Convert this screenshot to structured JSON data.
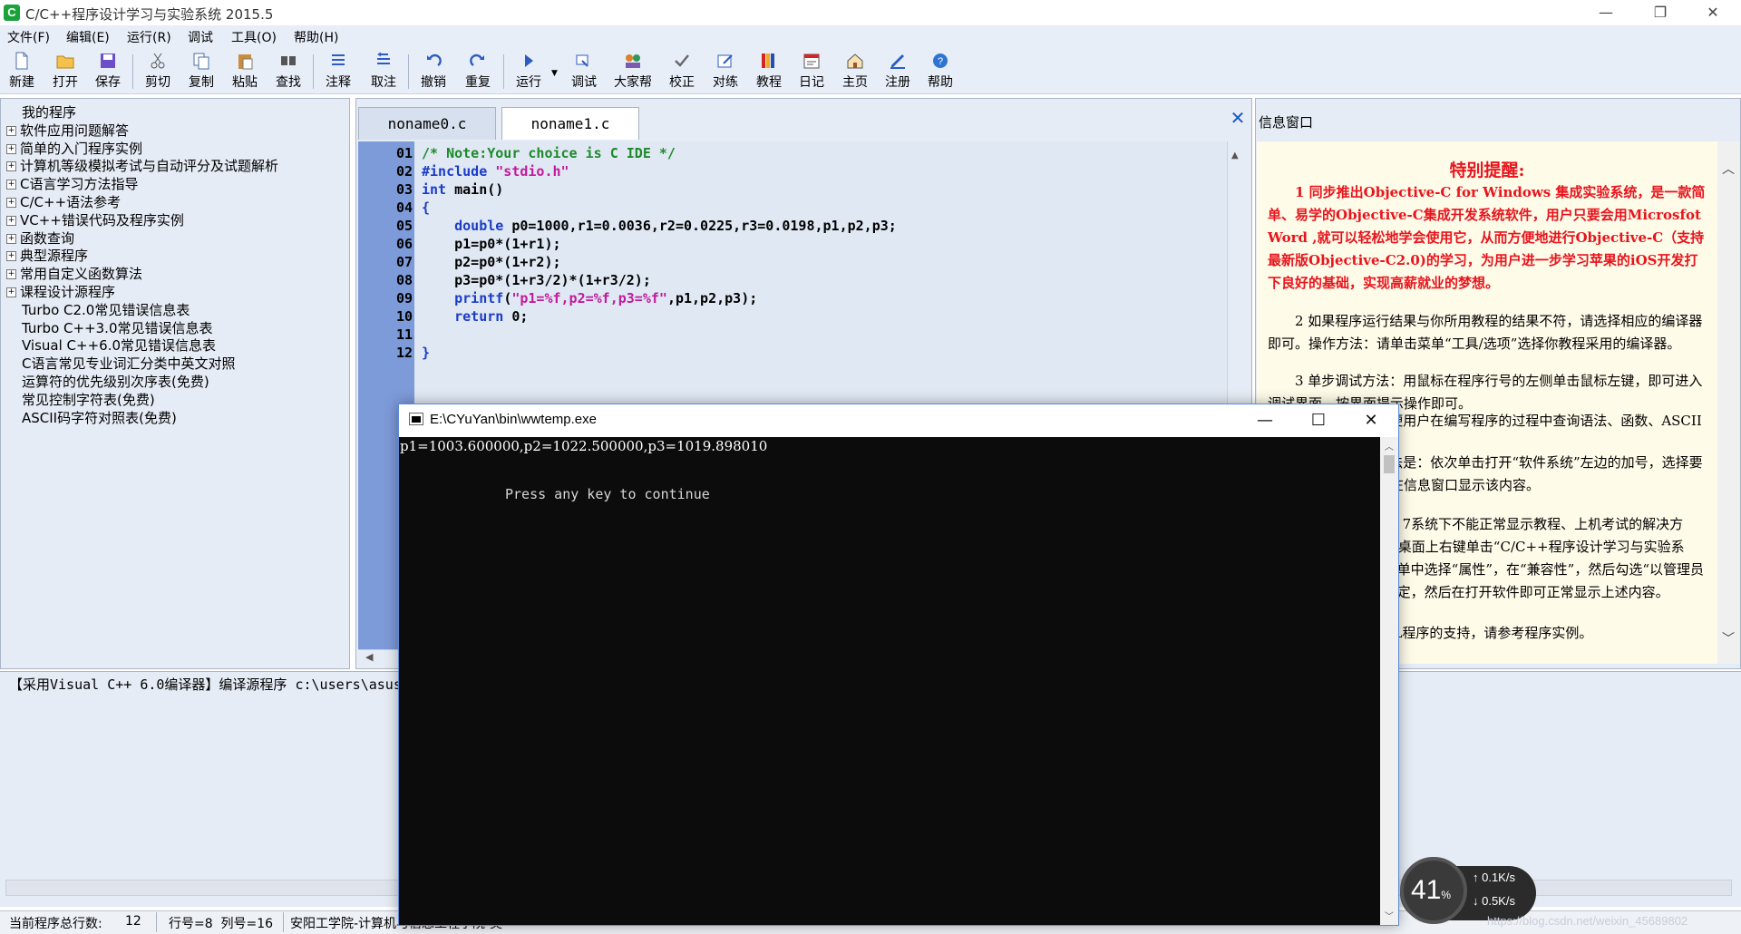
{
  "window": {
    "title": "C/C++程序设计学习与实验系统 2015.5",
    "app_icon": "C",
    "controls": {
      "minimize": "—",
      "maximize": "❐",
      "close": "✕"
    }
  },
  "menu": [
    "文件(F)",
    "编辑(E)",
    "运行(R)",
    "调试",
    "工具(O)",
    "帮助(H)"
  ],
  "toolbar": [
    {
      "label": "新建",
      "icon": "new-file-icon"
    },
    {
      "label": "打开",
      "icon": "open-folder-icon"
    },
    {
      "label": "保存",
      "icon": "save-icon"
    },
    {
      "label": "剪切",
      "icon": "cut-icon"
    },
    {
      "label": "复制",
      "icon": "copy-icon"
    },
    {
      "label": "粘贴",
      "icon": "paste-icon"
    },
    {
      "label": "查找",
      "icon": "find-icon"
    },
    {
      "label": "注释",
      "icon": "comment-icon"
    },
    {
      "label": "取注",
      "icon": "uncomment-icon"
    },
    {
      "label": "撤销",
      "icon": "undo-icon"
    },
    {
      "label": "重复",
      "icon": "redo-icon"
    },
    {
      "label": "运行",
      "icon": "run-icon"
    },
    {
      "label": "调试",
      "icon": "debug-icon"
    },
    {
      "label": "大家帮",
      "icon": "people-icon"
    },
    {
      "label": "校正",
      "icon": "check-icon"
    },
    {
      "label": "对练",
      "icon": "practice-icon"
    },
    {
      "label": "教程",
      "icon": "books-icon"
    },
    {
      "label": "日记",
      "icon": "calendar-icon"
    },
    {
      "label": "主页",
      "icon": "home-icon"
    },
    {
      "label": "注册",
      "icon": "register-icon"
    },
    {
      "label": "帮助",
      "icon": "help-icon"
    }
  ],
  "tree": [
    {
      "label": "我的程序",
      "expandable": false
    },
    {
      "label": "软件应用问题解答",
      "expandable": true
    },
    {
      "label": "简单的入门程序实例",
      "expandable": true
    },
    {
      "label": "计算机等级模拟考试与自动评分及试题解析",
      "expandable": true
    },
    {
      "label": "C语言学习方法指导",
      "expandable": true
    },
    {
      "label": "C/C++语法参考",
      "expandable": true
    },
    {
      "label": "VC++错误代码及程序实例",
      "expandable": true
    },
    {
      "label": "函数查询",
      "expandable": true
    },
    {
      "label": "典型源程序",
      "expandable": true
    },
    {
      "label": "常用自定义函数算法",
      "expandable": true
    },
    {
      "label": "课程设计源程序",
      "expandable": true
    },
    {
      "label": "Turbo C2.0常见错误信息表",
      "expandable": false
    },
    {
      "label": "Turbo C++3.0常见错误信息表",
      "expandable": false
    },
    {
      "label": "Visual C++6.0常见错误信息表",
      "expandable": false
    },
    {
      "label": "C语言常见专业词汇分类中英文对照",
      "expandable": false
    },
    {
      "label": "运算符的优先级别次序表(免费)",
      "expandable": false
    },
    {
      "label": "常见控制字符表(免费)",
      "expandable": false
    },
    {
      "label": "ASCII码字符对照表(免费)",
      "expandable": false
    }
  ],
  "editor": {
    "tabs": [
      {
        "label": "noname0.c",
        "active": false
      },
      {
        "label": "noname1.c",
        "active": true
      }
    ],
    "close_glyph": "✕",
    "line_numbers": [
      "01",
      "02",
      "03",
      "04",
      "05",
      "06",
      "07",
      "08",
      "09",
      "10",
      "11",
      "12"
    ],
    "lines": [
      "/* Note:Your choice is C IDE */",
      "#include \"stdio.h\"",
      "int main()",
      "{",
      "    double p0=1000,r1=0.0036,r2=0.0225,r3=0.0198,p1,p2,p3;",
      "    p1=p0*(1+r1);",
      "    p2=p0*(1+r2);",
      "    p3=p0*(1+r3/2)*(1+r3/2);",
      "    printf(\"p1=%f,p2=%f,p3=%f\",p1,p2,p3);",
      "    return 0;",
      "",
      "}"
    ]
  },
  "info": {
    "title": "信息窗口",
    "heading": "特别提醒:",
    "paragraphs": [
      {
        "red": true,
        "text": "1 同步推出Objective-C for Windows 集成实验系统，是一款简单、易学的Objective-C集成开发系统软件，用户只要会用Microsfot Word ,就可以轻松地学会使用它，从而方便地进行Objective-C（支持最新版Objective-C2.0)的学习，为用户进一步学习苹果的iOS开发打下良好的基础，实现高薪就业的梦想。"
      },
      {
        "red": false,
        "text": "2 如果程序运行结果与你所用教程的结果不符，请选择相应的编译器即可。操作方法：请单击菜单“工具/选项”选择你教程采用的编译器。"
      },
      {
        "red": false,
        "text": "3 单步调试方法：用鼠标在程序行号的左侧单击鼠标左键，即可进入调试界面，按界面提示操作即可。"
      },
      {
        "red": false,
        "text": "4 软件的作用方便用户在编写程序的过程中查询语法、函数、ASCII等。"
      },
      {
        "red": false,
        "text": "5 软件的使用方法是：依次单击打开“软件系统”左边的加号，选择要打开的内容，就可以在信息窗口显示该内容。"
      },
      {
        "red": false,
        "text": "6 在WINDOWS 7系统下不能正常显示教程、上机考试的解决方法：在WINDOWS 7桌面上右键单击“C/C++程序设计学习与实验系统”图标，在弹出的菜单中选择“属性”，在“兼容性”，然后勾选“以管理员身份运行此程序”，确定，然后在打开软件即可正常显示上述内容。"
      },
      {
        "red": false,
        "text": "7 软件对openGL程序的支持，请参考程序实例。"
      }
    ]
  },
  "output": {
    "text": "【采用Visual C++ 6.0编译器】编译源程序 c:\\users\\asus"
  },
  "status": {
    "total_lines_label": "当前程序总行数:",
    "total_lines": "12",
    "row_col": "行号=8  列号=16",
    "school": "安阳工学院-计算机与信息工程学院-吴"
  },
  "console": {
    "title": "E:\\CYuYan\\bin\\wwtemp.exe",
    "line1": "p1=1003.600000,p2=1022.500000,p3=1019.898010",
    "line2": "Press any key to continue",
    "controls": {
      "minimize": "—",
      "maximize": "☐",
      "close": "✕"
    }
  },
  "network": {
    "percent": "41",
    "percent_unit": "%",
    "up": "↑ 0.1K/s",
    "down": "↓ 0.5K/s"
  },
  "watermark": "https://blog.csdn.net/weixin_45689802",
  "colors": {
    "chrome_bg": "#e8eef8",
    "gutter": "#7d9ad9",
    "code_bg": "#e0e8f3",
    "keyword": "#1a3cc8",
    "comment": "#1d8a2a",
    "string": "#c21a9c",
    "warning_red": "#e8141c"
  }
}
